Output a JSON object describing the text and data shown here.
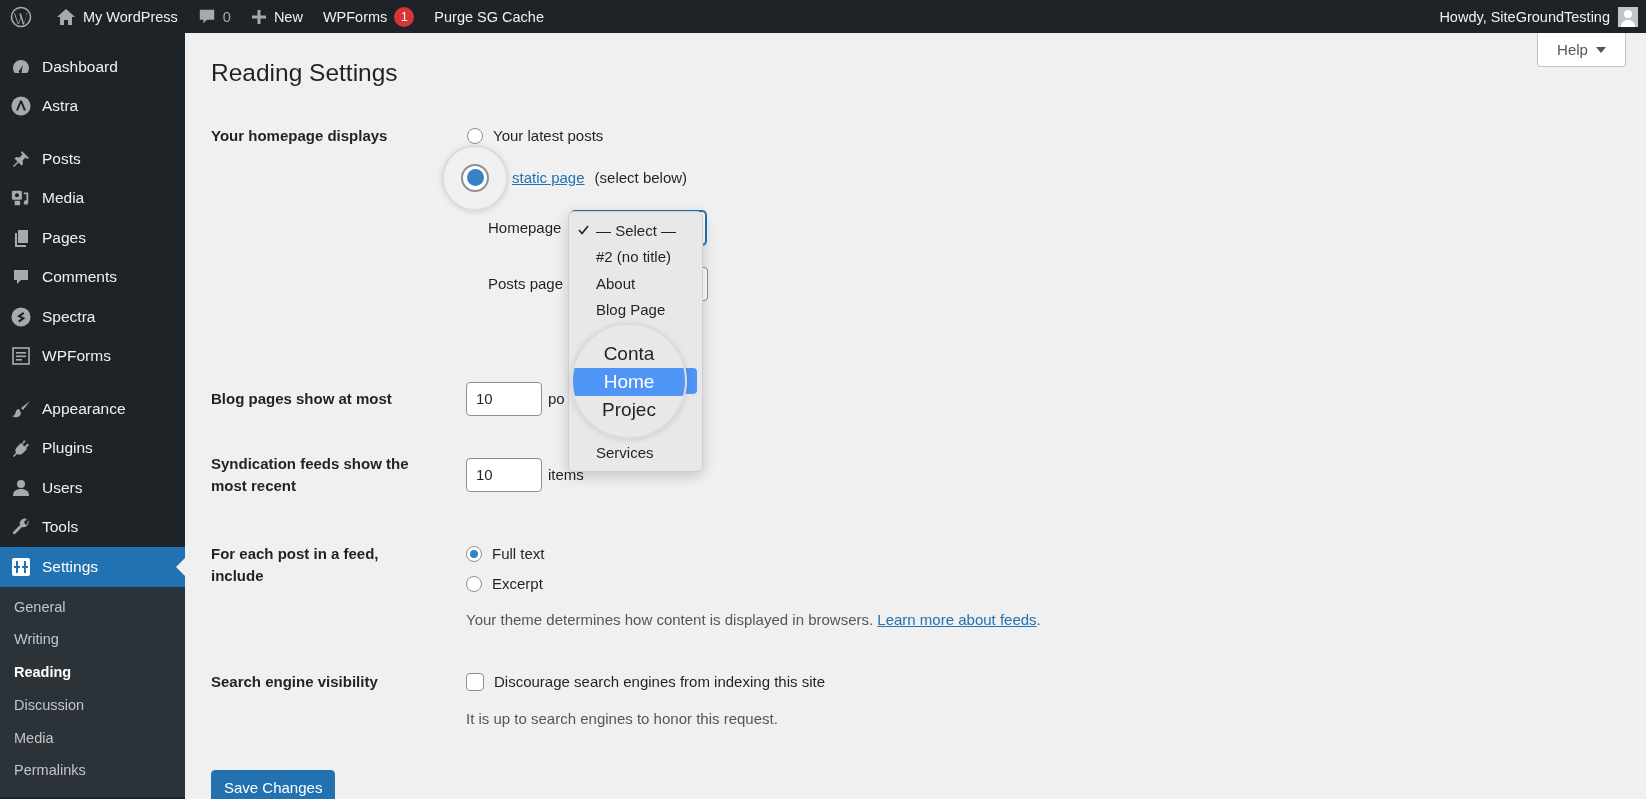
{
  "admin_bar": {
    "site": "My WordPress",
    "comments": "0",
    "new": "New",
    "wpforms": "WPForms",
    "wpforms_badge": "1",
    "purge": "Purge SG Cache",
    "howdy": "Howdy, SiteGroundTesting"
  },
  "sidebar": {
    "groups": [
      {
        "items": [
          {
            "label": "Dashboard",
            "selected": false
          },
          {
            "label": "Astra",
            "selected": false
          }
        ]
      },
      {
        "items": [
          {
            "label": "Posts",
            "selected": false
          },
          {
            "label": "Media",
            "selected": false
          },
          {
            "label": "Pages",
            "selected": false
          },
          {
            "label": "Comments",
            "selected": false
          },
          {
            "label": "Spectra",
            "selected": false
          },
          {
            "label": "WPForms",
            "selected": false
          }
        ]
      },
      {
        "items": [
          {
            "label": "Appearance",
            "selected": false
          },
          {
            "label": "Plugins",
            "selected": false
          },
          {
            "label": "Users",
            "selected": false
          },
          {
            "label": "Tools",
            "selected": false
          },
          {
            "label": "Settings",
            "selected": true
          }
        ]
      }
    ],
    "submenu": [
      {
        "label": "General",
        "selected": false
      },
      {
        "label": "Writing",
        "selected": false
      },
      {
        "label": "Reading",
        "selected": true
      },
      {
        "label": "Discussion",
        "selected": false
      },
      {
        "label": "Media",
        "selected": false
      },
      {
        "label": "Permalinks",
        "selected": false
      }
    ]
  },
  "help": "Help",
  "title": "Reading Settings",
  "homepage": {
    "label": "Your homepage displays",
    "options": [
      {
        "kind": "plain",
        "text": "Your latest posts",
        "selected": false
      },
      {
        "kind": "link",
        "link": "static page",
        "text": "(select below)",
        "selected": true
      }
    ],
    "selects": [
      {
        "label": "Homepage",
        "focused": true
      },
      {
        "label": "Posts page",
        "focused": false
      }
    ]
  },
  "dropdown": {
    "items": [
      {
        "kind": "regular",
        "label": "— Select —",
        "checked": true,
        "selected": false
      },
      {
        "kind": "regular",
        "label": "#2 (no title)",
        "checked": false,
        "selected": false
      },
      {
        "kind": "regular",
        "label": "About",
        "checked": false,
        "selected": false
      },
      {
        "kind": "regular",
        "label": "Blog Page",
        "checked": false,
        "selected": false
      },
      {
        "kind": "magnified",
        "label": "Conta",
        "checked": false,
        "selected": false
      },
      {
        "kind": "magnified",
        "label": "Home",
        "checked": false,
        "selected": true
      },
      {
        "kind": "magnified",
        "label": "Projec",
        "checked": false,
        "selected": false
      },
      {
        "kind": "regular",
        "label": "Services",
        "checked": false,
        "selected": false
      }
    ]
  },
  "blog_pages": {
    "label": "Blog pages show at most",
    "value": "10",
    "unit": "po"
  },
  "syndication": {
    "label": "Syndication feeds show the most recent",
    "value": "10",
    "unit": "items"
  },
  "feed_content": {
    "label": "For each post in a feed, include",
    "options": [
      {
        "text": "Full text",
        "selected": true
      },
      {
        "text": "Excerpt",
        "selected": false
      }
    ],
    "note": "Your theme determines how content is displayed in browsers.",
    "note_link": "Learn more about feeds",
    "note_end": "."
  },
  "search_visibility": {
    "label": "Search engine visibility",
    "checkbox": "Discourage search engines from indexing this site",
    "checked": false,
    "note": "It is up to search engines to honor this request."
  },
  "save": "Save Changes"
}
